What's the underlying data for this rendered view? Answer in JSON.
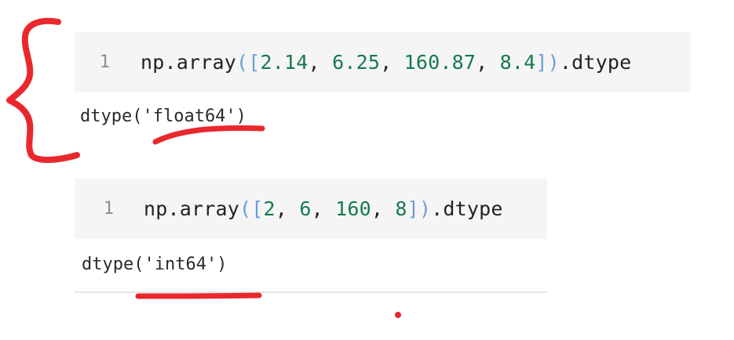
{
  "cells": [
    {
      "line_number": "1",
      "code": {
        "prefix": "np.array",
        "open": "([",
        "n1": "2.14",
        "sep1": ", ",
        "n2": "6.25",
        "sep2": ", ",
        "n3": "160.87",
        "sep3": ", ",
        "n4": "8.4",
        "close": "])",
        "suffix": ".dtype"
      },
      "output": "dtype('float64')"
    },
    {
      "line_number": "1",
      "code": {
        "prefix": "np.array",
        "open": "([",
        "n1": "2",
        "sep1": ", ",
        "n2": "6",
        "sep2": ", ",
        "n3": "160",
        "sep3": ", ",
        "n4": "8",
        "close": "])",
        "suffix": ".dtype"
      },
      "output": "dtype('int64')"
    }
  ],
  "colors": {
    "annotation": "#e8282d",
    "number": "#157a4f",
    "bracket": "#6aa0d9",
    "cell_background": "#f5f5f5"
  }
}
